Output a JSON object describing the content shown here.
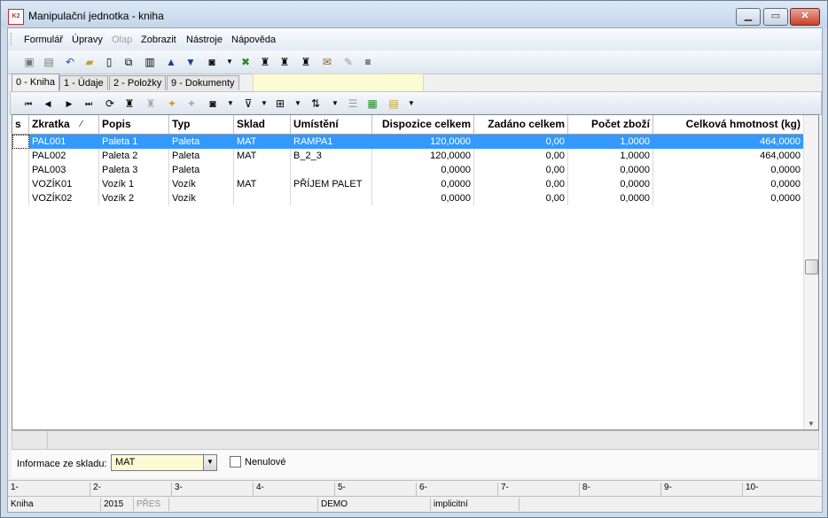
{
  "window": {
    "title": "Manipulační jednotka - kniha",
    "app_icon": "K2"
  },
  "menu": [
    "Formulář",
    "Úpravy",
    "Olap",
    "Zobrazit",
    "Nástroje",
    "Nápověda"
  ],
  "menu_disabled": [
    "Olap"
  ],
  "toolbar_icons": [
    "save-icon",
    "save-as-icon",
    "undo-icon",
    "open-folder-icon",
    "new-document-icon",
    "copy-icon",
    "book-icon",
    "arrow-up-icon",
    "arrow-down-icon",
    "camera-icon",
    "chevron-down-icon",
    "excel-icon",
    "binoculars-icon",
    "binoculars-next-icon",
    "binoculars-filter-icon",
    "mail-icon",
    "edit-icon",
    "menu-lines-icon"
  ],
  "tabs": [
    "0 - Kniha",
    "1 - Údaje",
    "2 - Položky",
    "9 - Dokumenty"
  ],
  "active_tab": "0 - Kniha",
  "grid": {
    "columns": [
      "s",
      "Zkratka",
      "Popis",
      "Typ",
      "Sklad",
      "Umístění",
      "Dispozice celkem",
      "Zadáno celkem",
      "Počet zboží",
      "Celková hmotnost (kg)"
    ],
    "sort_indicator": "⁄",
    "rows": [
      {
        "s": "",
        "zkratka": "PAL001",
        "popis": "Paleta 1",
        "typ": "Paleta",
        "sklad": "MAT",
        "umisteni": "RAMPA1",
        "dispozice": "120,0000",
        "zadano": "0,00",
        "pocet": "1,0000",
        "hmotnost": "464,0000"
      },
      {
        "s": "",
        "zkratka": "PAL002",
        "popis": "Paleta 2",
        "typ": "Paleta",
        "sklad": "MAT",
        "umisteni": "B_2_3",
        "dispozice": "120,0000",
        "zadano": "0,00",
        "pocet": "1,0000",
        "hmotnost": "464,0000"
      },
      {
        "s": "",
        "zkratka": "PAL003",
        "popis": "Paleta 3",
        "typ": "Paleta",
        "sklad": "",
        "umisteni": "",
        "dispozice": "0,0000",
        "zadano": "0,00",
        "pocet": "0,0000",
        "hmotnost": "0,0000"
      },
      {
        "s": "",
        "zkratka": "VOZÍK01",
        "popis": "Vozík 1",
        "typ": "Vozík",
        "sklad": "MAT",
        "umisteni": "PŘÍJEM PALET",
        "dispozice": "0,0000",
        "zadano": "0,00",
        "pocet": "0,0000",
        "hmotnost": "0,0000"
      },
      {
        "s": "",
        "zkratka": "VOZÍK02",
        "popis": "Vozík 2",
        "typ": "Vozík",
        "sklad": "",
        "umisteni": "",
        "dispozice": "0,0000",
        "zadano": "0,00",
        "pocet": "0,0000",
        "hmotnost": "0,0000"
      }
    ],
    "selected_row": 0
  },
  "info": {
    "label": "Informace ze skladu:",
    "select_value": "MAT",
    "checkbox_label": "Nenulové",
    "checkbox_checked": false
  },
  "function_keys": [
    "1-",
    "2-",
    "3-",
    "4-",
    "5-",
    "6-",
    "7-",
    "8-",
    "9-",
    "10-"
  ],
  "status": {
    "book": "Kniha",
    "year": "2015",
    "mode": "PŘES",
    "db": "DEMO",
    "profile": "implicitní"
  },
  "colors": {
    "selection": "#3399ff",
    "highlight_field": "#fdfbd3",
    "close_button": "#c7412a"
  }
}
